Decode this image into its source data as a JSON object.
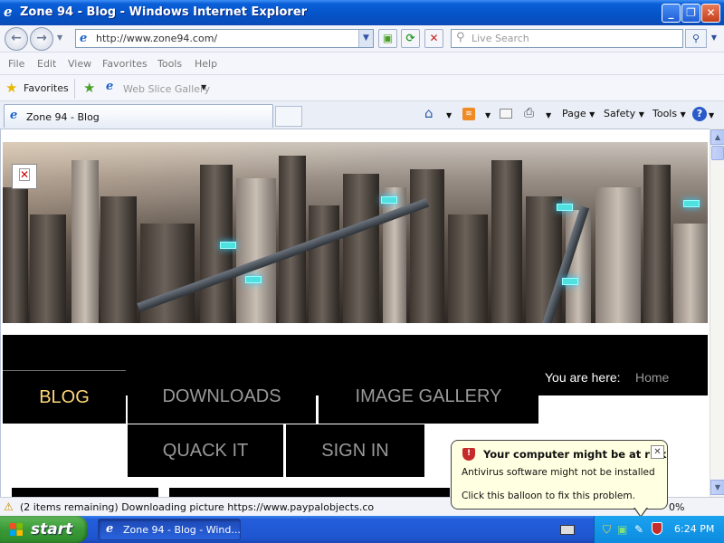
{
  "window": {
    "title": "Zone 94 - Blog - Windows Internet Explorer",
    "min": "_",
    "max": "❐",
    "close": "✕"
  },
  "address": {
    "url": "http://www.zone94.com/",
    "search_placeholder": "Live Search"
  },
  "menu": [
    "File",
    "Edit",
    "View",
    "Favorites",
    "Tools",
    "Help"
  ],
  "favorites_bar": {
    "favorites_label": "Favorites",
    "web_slice_label": "Web Slice Gallery"
  },
  "tabs": {
    "active_label": "Zone 94 - Blog"
  },
  "command_bar": {
    "page": "Page",
    "safety": "Safety",
    "tools": "Tools"
  },
  "site": {
    "nav": {
      "blog": "BLOG",
      "downloads": "DOWNLOADS",
      "image_gallery": "IMAGE GALLERY",
      "quack_it": "QUACK IT",
      "sign_in": "SIGN IN"
    },
    "breadcrumb": {
      "label": "You are here:",
      "home": "Home"
    }
  },
  "status": {
    "text": "(2 items remaining) Downloading picture https://www.paypalobjects.co",
    "zoom": "0%"
  },
  "balloon": {
    "title": "Your computer might be at risk",
    "line1": "Antivirus software might not be installed",
    "line2": "Click this balloon to fix this problem."
  },
  "taskbar": {
    "start_label": "start",
    "task_label": "Zone 94 - Blog - Wind...",
    "clock": "6:24 PM"
  },
  "colors": {
    "titlebar": "#0553c7",
    "taskbar": "#245edb",
    "start_button": "#3a9a36",
    "nav_active_text": "#ffd77a",
    "balloon_bg": "#ffffe1"
  },
  "icons": [
    "ie-icon",
    "back-arrow-icon",
    "forward-arrow-icon",
    "refresh-icon",
    "stop-icon",
    "search-icon",
    "star-icon",
    "home-icon",
    "rss-icon",
    "print-icon",
    "help-icon",
    "shield-icon",
    "warning-icon",
    "windows-flag-icon"
  ]
}
